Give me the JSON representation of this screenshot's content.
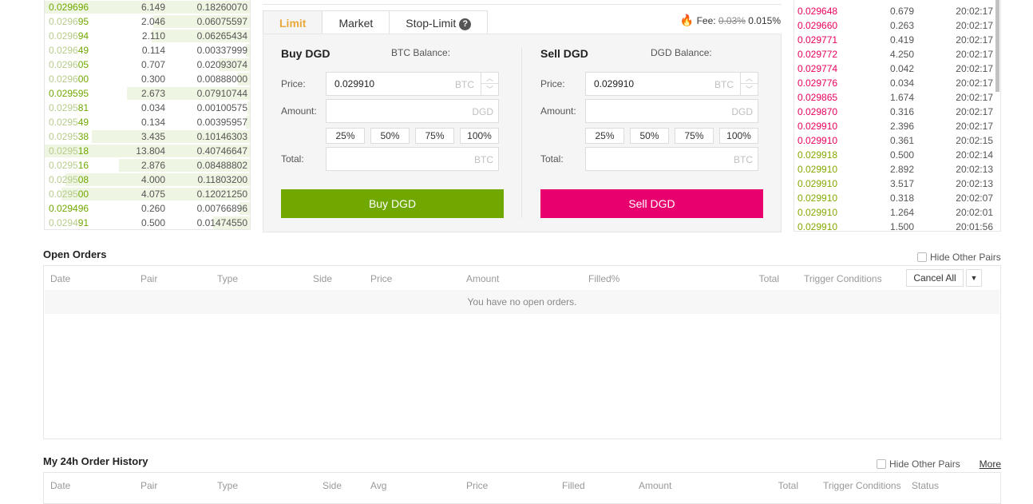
{
  "order_book": [
    {
      "pre": "",
      "suf": "0.029696",
      "amount": "6.149",
      "total": "0.18260070",
      "depth": 1.0
    },
    {
      "pre": "0.0296",
      "suf": "95",
      "amount": "2.046",
      "total": "0.06075597",
      "depth": 0.47
    },
    {
      "pre": "0.0296",
      "suf": "94",
      "amount": "2.110",
      "total": "0.06265434",
      "depth": 0.48
    },
    {
      "pre": "0.0296",
      "suf": "49",
      "amount": "0.114",
      "total": "0.00337999",
      "depth": 0.02
    },
    {
      "pre": "0.0296",
      "suf": "05",
      "amount": "0.707",
      "total": "0.02093074",
      "depth": 0.15
    },
    {
      "pre": "0.0296",
      "suf": "00",
      "amount": "0.300",
      "total": "0.00888000",
      "depth": 0.06
    },
    {
      "pre": "",
      "suf": "0.029595",
      "amount": "2.673",
      "total": "0.07910744",
      "depth": 0.6
    },
    {
      "pre": "0.0295",
      "suf": "81",
      "amount": "0.034",
      "total": "0.00100575",
      "depth": 0.01
    },
    {
      "pre": "0.0295",
      "suf": "49",
      "amount": "0.134",
      "total": "0.00395957",
      "depth": 0.02
    },
    {
      "pre": "0.0295",
      "suf": "38",
      "amount": "3.435",
      "total": "0.10146303",
      "depth": 0.77
    },
    {
      "pre": "0.0295",
      "suf": "18",
      "amount": "13.804",
      "total": "0.40746647",
      "depth": 1.0
    },
    {
      "pre": "0.0295",
      "suf": "16",
      "amount": "2.876",
      "total": "0.08488802",
      "depth": 0.64
    },
    {
      "pre": "0.0295",
      "suf": "08",
      "amount": "4.000",
      "total": "0.11803200",
      "depth": 0.9
    },
    {
      "pre": "0.0295",
      "suf": "00",
      "amount": "4.075",
      "total": "0.12021250",
      "depth": 0.92
    },
    {
      "pre": "",
      "suf": "0.029496",
      "amount": "0.260",
      "total": "0.00766896",
      "depth": 0.05
    },
    {
      "pre": "0.0294",
      "suf": "91",
      "amount": "0.500",
      "total": "0.01474550",
      "depth": 0.18
    }
  ],
  "trades": [
    {
      "price": "0.029648",
      "amount": "0.679",
      "time": "20:02:17",
      "side": "sell"
    },
    {
      "price": "0.029660",
      "amount": "0.263",
      "time": "20:02:17",
      "side": "sell"
    },
    {
      "price": "0.029771",
      "amount": "0.419",
      "time": "20:02:17",
      "side": "sell"
    },
    {
      "price": "0.029772",
      "amount": "4.250",
      "time": "20:02:17",
      "side": "sell"
    },
    {
      "price": "0.029774",
      "amount": "0.042",
      "time": "20:02:17",
      "side": "sell"
    },
    {
      "price": "0.029776",
      "amount": "0.034",
      "time": "20:02:17",
      "side": "sell"
    },
    {
      "price": "0.029865",
      "amount": "1.674",
      "time": "20:02:17",
      "side": "sell"
    },
    {
      "price": "0.029870",
      "amount": "0.316",
      "time": "20:02:17",
      "side": "sell"
    },
    {
      "price": "0.029910",
      "amount": "2.396",
      "time": "20:02:17",
      "side": "sell"
    },
    {
      "price": "0.029910",
      "amount": "0.361",
      "time": "20:02:15",
      "side": "sell"
    },
    {
      "price": "0.029918",
      "amount": "0.500",
      "time": "20:02:14",
      "side": "buy"
    },
    {
      "price": "0.029910",
      "amount": "2.892",
      "time": "20:02:13",
      "side": "buy"
    },
    {
      "price": "0.029910",
      "amount": "3.517",
      "time": "20:02:13",
      "side": "buy"
    },
    {
      "price": "0.029910",
      "amount": "0.318",
      "time": "20:02:07",
      "side": "buy"
    },
    {
      "price": "0.029910",
      "amount": "1.264",
      "time": "20:02:01",
      "side": "buy"
    },
    {
      "price": "0.029910",
      "amount": "1.500",
      "time": "20:01:56",
      "side": "buy"
    }
  ],
  "tabs": {
    "limit": "Limit",
    "market": "Market",
    "stop_limit": "Stop-Limit",
    "help": "?"
  },
  "fee": {
    "label": "Fee:",
    "old": "0.03%",
    "new": "0.015%"
  },
  "buy": {
    "title": "Buy DGD",
    "balance": "BTC Balance:",
    "price_label": "Price:",
    "price": "0.029910",
    "price_unit": "BTC",
    "amount_label": "Amount:",
    "amount_unit": "DGD",
    "total_label": "Total:",
    "total_unit": "BTC",
    "button": "Buy DGD"
  },
  "sell": {
    "title": "Sell DGD",
    "balance": "DGD Balance:",
    "price_label": "Price:",
    "price": "0.029910",
    "price_unit": "BTC",
    "amount_label": "Amount:",
    "amount_unit": "DGD",
    "total_label": "Total:",
    "total_unit": "BTC",
    "button": "Sell DGD"
  },
  "percents": [
    "25%",
    "50%",
    "75%",
    "100%"
  ],
  "colors": {
    "buy": "#70a800",
    "sell": "#e8006f",
    "accent": "#e9a83b"
  },
  "open_orders": {
    "title": "Open Orders",
    "hide_other": "Hide Other Pairs",
    "columns": [
      "Date",
      "Pair",
      "Type",
      "Side",
      "Price",
      "Amount",
      "Filled%",
      "Total",
      "Trigger Conditions"
    ],
    "empty": "You have no open orders.",
    "cancel_all": "Cancel All"
  },
  "history": {
    "title": "My 24h Order History",
    "hide_other": "Hide Other Pairs",
    "more": "More",
    "columns": [
      "Date",
      "Pair",
      "Type",
      "Side",
      "Avg",
      "Price",
      "Filled",
      "Amount",
      "Total",
      "Trigger Conditions",
      "Status"
    ]
  }
}
